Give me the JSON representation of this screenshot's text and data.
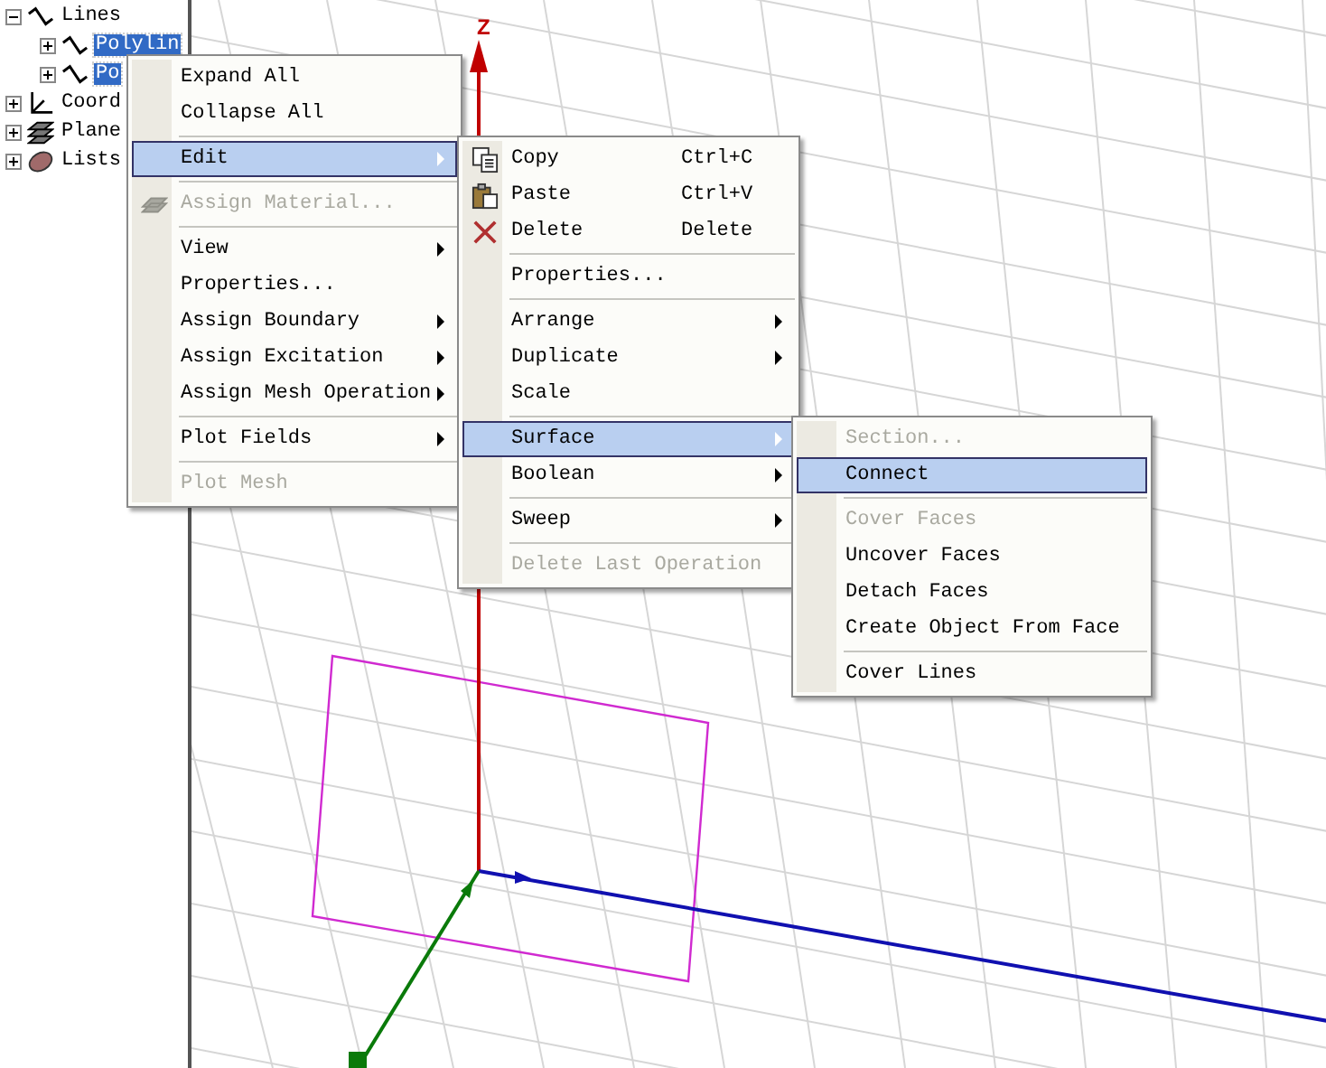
{
  "tree": [
    {
      "label": "Lines",
      "expanded": true,
      "selected": false,
      "children": [
        {
          "label": "Polylin",
          "expanded": false,
          "selected": true
        },
        {
          "label": "Po",
          "expanded": false,
          "selected": true
        }
      ]
    },
    {
      "label": "Coord",
      "expanded": false,
      "selected": false
    },
    {
      "label": "Plane",
      "expanded": false,
      "selected": false
    },
    {
      "label": "Lists",
      "expanded": false,
      "selected": false
    }
  ],
  "viewport": {
    "axis_label": "Z"
  },
  "menus": [
    {
      "items": [
        {
          "kind": "item",
          "label": "Expand All",
          "disabled": false,
          "selected": false,
          "submenu": false
        },
        {
          "kind": "item",
          "label": "Collapse All",
          "disabled": false,
          "selected": false,
          "submenu": false
        },
        {
          "kind": "separator"
        },
        {
          "kind": "item",
          "label": "Edit",
          "disabled": false,
          "selected": true,
          "submenu": true
        },
        {
          "kind": "separator"
        },
        {
          "kind": "item",
          "label": "Assign Material...",
          "disabled": true,
          "selected": false,
          "submenu": false
        },
        {
          "kind": "separator"
        },
        {
          "kind": "item",
          "label": "View",
          "disabled": false,
          "selected": false,
          "submenu": true
        },
        {
          "kind": "item",
          "label": "Properties...",
          "disabled": false,
          "selected": false,
          "submenu": false
        },
        {
          "kind": "item",
          "label": "Assign Boundary",
          "disabled": false,
          "selected": false,
          "submenu": true
        },
        {
          "kind": "item",
          "label": "Assign Excitation",
          "disabled": false,
          "selected": false,
          "submenu": true
        },
        {
          "kind": "item",
          "label": "Assign Mesh Operation",
          "disabled": false,
          "selected": false,
          "submenu": true
        },
        {
          "kind": "separator"
        },
        {
          "kind": "item",
          "label": "Plot Fields",
          "disabled": false,
          "selected": false,
          "submenu": true
        },
        {
          "kind": "separator"
        },
        {
          "kind": "item",
          "label": "Plot Mesh",
          "disabled": true,
          "selected": false,
          "submenu": false
        }
      ]
    },
    {
      "items": [
        {
          "kind": "item",
          "label": "Copy",
          "shortcut": "Ctrl+C",
          "disabled": false,
          "selected": false,
          "submenu": false
        },
        {
          "kind": "item",
          "label": "Paste",
          "shortcut": "Ctrl+V",
          "disabled": false,
          "selected": false,
          "submenu": false
        },
        {
          "kind": "item",
          "label": "Delete",
          "shortcut": "Delete",
          "disabled": false,
          "selected": false,
          "submenu": false
        },
        {
          "kind": "separator"
        },
        {
          "kind": "item",
          "label": "Properties...",
          "disabled": false,
          "selected": false,
          "submenu": false
        },
        {
          "kind": "separator"
        },
        {
          "kind": "item",
          "label": "Arrange",
          "disabled": false,
          "selected": false,
          "submenu": true
        },
        {
          "kind": "item",
          "label": "Duplicate",
          "disabled": false,
          "selected": false,
          "submenu": true
        },
        {
          "kind": "item",
          "label": "Scale",
          "disabled": false,
          "selected": false,
          "submenu": false
        },
        {
          "kind": "separator"
        },
        {
          "kind": "item",
          "label": "Surface",
          "disabled": false,
          "selected": true,
          "submenu": true
        },
        {
          "kind": "item",
          "label": "Boolean",
          "disabled": false,
          "selected": false,
          "submenu": true
        },
        {
          "kind": "separator"
        },
        {
          "kind": "item",
          "label": "Sweep",
          "disabled": false,
          "selected": false,
          "submenu": true
        },
        {
          "kind": "separator"
        },
        {
          "kind": "item",
          "label": "Delete Last Operation",
          "disabled": true,
          "selected": false,
          "submenu": false
        }
      ]
    },
    {
      "items": [
        {
          "kind": "item",
          "label": "Section...",
          "disabled": true,
          "selected": false,
          "submenu": false
        },
        {
          "kind": "item",
          "label": "Connect",
          "disabled": false,
          "selected": true,
          "submenu": false
        },
        {
          "kind": "separator"
        },
        {
          "kind": "item",
          "label": "Cover Faces",
          "disabled": true,
          "selected": false,
          "submenu": false
        },
        {
          "kind": "item",
          "label": "Uncover Faces",
          "disabled": false,
          "selected": false,
          "submenu": false
        },
        {
          "kind": "item",
          "label": "Detach Faces",
          "disabled": false,
          "selected": false,
          "submenu": false
        },
        {
          "kind": "item",
          "label": "Create Object From Face",
          "disabled": false,
          "selected": false,
          "submenu": false
        },
        {
          "kind": "separator"
        },
        {
          "kind": "item",
          "label": "Cover Lines",
          "disabled": false,
          "selected": false,
          "submenu": false
        }
      ]
    }
  ]
}
